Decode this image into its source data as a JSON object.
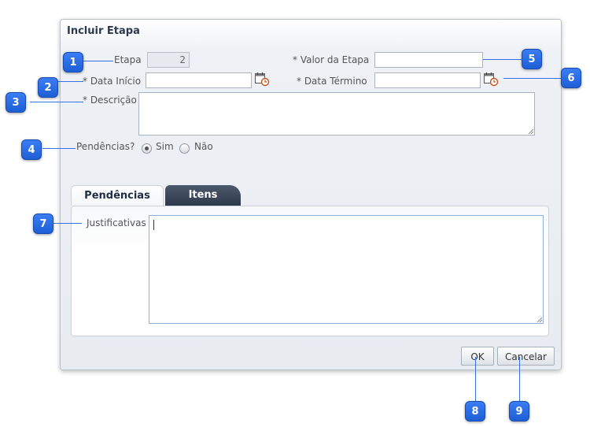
{
  "dialog": {
    "title": "Incluir Etapa",
    "etapa_label": "Etapa",
    "etapa_value": "2",
    "valor_label": "* Valor da Etapa",
    "valor_value": "",
    "data_inicio_label": "* Data Início",
    "data_inicio_value": "",
    "data_termino_label": "* Data Término",
    "data_termino_value": "",
    "descricao_label": "* Descrição",
    "pendencias_label": "Pendências?",
    "sim_label": "Sim",
    "nao_label": "Não",
    "pendencias_selected": "Sim",
    "tabs": [
      {
        "label": "Pendências",
        "active": true
      },
      {
        "label": "Itens",
        "active": false
      }
    ],
    "justificativas_label": "Justificativas",
    "ok_label": "OK",
    "cancel_label": "Cancelar"
  },
  "callouts": [
    "1",
    "2",
    "3",
    "4",
    "5",
    "6",
    "7",
    "8",
    "9"
  ],
  "colors": {
    "callout": "#2f6fe8",
    "tab_inactive": "#3a4657",
    "dialog_border": "#b9c1cc"
  },
  "icons": {
    "calendar": "calendar-clock-icon"
  }
}
